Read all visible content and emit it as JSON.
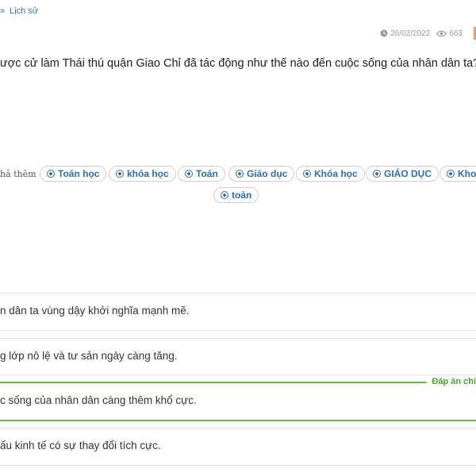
{
  "breadcrumb": {
    "separator": "»",
    "current": "Lịch sử"
  },
  "meta": {
    "date": "26/02/2022",
    "views": "663",
    "clock_icon": "clock-icon",
    "eye_icon": "eye-icon"
  },
  "question": {
    "text": "ược cử làm Thái thú quận Giao Chỉ đã tác động như thế nào đến cuộc sống của nhân dân ta?"
  },
  "tags": {
    "label": "hả thêm",
    "items": [
      "Toán học",
      "khóa học",
      "Toán",
      "Giáo dục",
      "Khóa học",
      "GIÁO DỤC",
      "Khoa",
      "toàn"
    ]
  },
  "answers": {
    "correct_label": "Đáp án chí",
    "options": [
      "n dân ta vùng dậy khởi nghĩa mạnh mẽ.",
      "g lớp nô lệ và tư sản ngày càng tăng.",
      "c sống của nhân dân càng thêm khổ cực.",
      "ấu kinh tế có sự thay đổi tích cực."
    ]
  },
  "colors": {
    "link": "#2f6db5",
    "correct": "#6cbd45",
    "accent_edge": "#f39c6b"
  }
}
